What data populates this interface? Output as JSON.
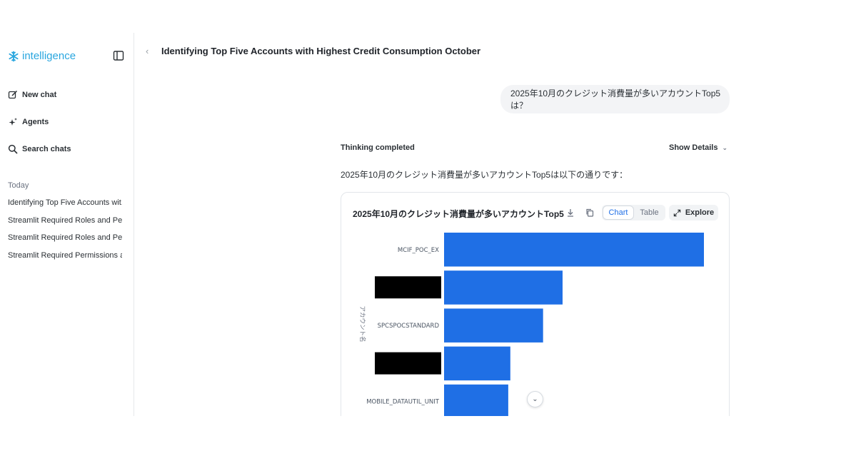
{
  "app": {
    "name": "intelligence",
    "brand_color": "#29a6df"
  },
  "sidebar": {
    "nav": [
      {
        "label": "New chat",
        "icon": "new-chat-icon"
      },
      {
        "label": "Agents",
        "icon": "sparkle-icon"
      },
      {
        "label": "Search chats",
        "icon": "search-icon"
      }
    ],
    "section_label": "Today",
    "history": [
      "Identifying Top Five Accounts wit...",
      "Streamlit Required Roles and Per...",
      "Streamlit Required Roles and Per...",
      "Streamlit Required Permissions a..."
    ]
  },
  "header": {
    "title": "Identifying Top Five Accounts with Highest Credit Consumption October"
  },
  "conversation": {
    "user_message": "2025年10月のクレジット消費量が多いアカウントTop5は？",
    "thinking_status": "Thinking completed",
    "show_details": "Show Details",
    "answer_text": "2025年10月のクレジット消費量が多いアカウントTop5は以下の通りです："
  },
  "chart_card": {
    "toolbar": {
      "chart_tab": "Chart",
      "table_tab": "Table",
      "explore": "Explore"
    },
    "bar_color": "#1f6fe5"
  },
  "chart_data": {
    "type": "bar",
    "orientation": "horizontal",
    "title": "2025年10月のクレジット消費量が多いアカウントTop5",
    "ylabel": "アカウント名",
    "categories": [
      "MCIF_POC_EX",
      "",
      "SPCSPOCSTANDARD",
      "",
      "MOBILE_DATAUTIL_UNIT"
    ],
    "redacted": [
      false,
      true,
      false,
      true,
      false
    ],
    "values": [
      100,
      45.6,
      38.1,
      25.5,
      24.7
    ],
    "xlim": [
      0,
      100
    ],
    "grid": false
  }
}
